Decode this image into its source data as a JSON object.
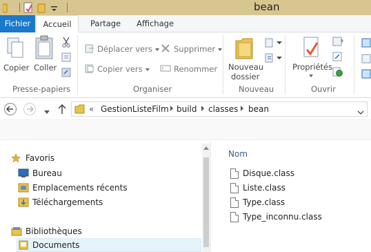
{
  "window": {
    "title": "bean"
  },
  "tabs": [
    {
      "label": "Fichier"
    },
    {
      "label": "Accueil"
    },
    {
      "label": "Partage"
    },
    {
      "label": "Affichage"
    }
  ],
  "ribbon": {
    "clipboard": {
      "group": "Presse-papiers",
      "copy": "Copier",
      "paste": "Coller"
    },
    "organize": {
      "group": "Organiser",
      "move_to": "Déplacer vers",
      "copy_to": "Copier vers",
      "delete": "Supprimer",
      "rename": "Renommer"
    },
    "new": {
      "group": "Nouveau",
      "new_folder_line1": "Nouveau",
      "new_folder_line2": "dossier"
    },
    "open": {
      "group": "Ouvrir",
      "properties": "Propriétés"
    }
  },
  "address": {
    "overflow": "«",
    "crumbs": [
      "GestionListeFilm",
      "build",
      "classes",
      "bean"
    ]
  },
  "nav": {
    "favorites": "Favoris",
    "desktop": "Bureau",
    "recent": "Emplacements récents",
    "downloads": "Téléchargements",
    "libraries": "Bibliothèques",
    "documents": "Documents"
  },
  "content": {
    "column_name": "Nom",
    "files": [
      "Disque.class",
      "Liste.class",
      "Type.class",
      "Type_inconnu.class"
    ]
  },
  "colors": {
    "accent": "#1979ca",
    "titlebar": "#d8c690",
    "folder": "#e9c34a"
  }
}
